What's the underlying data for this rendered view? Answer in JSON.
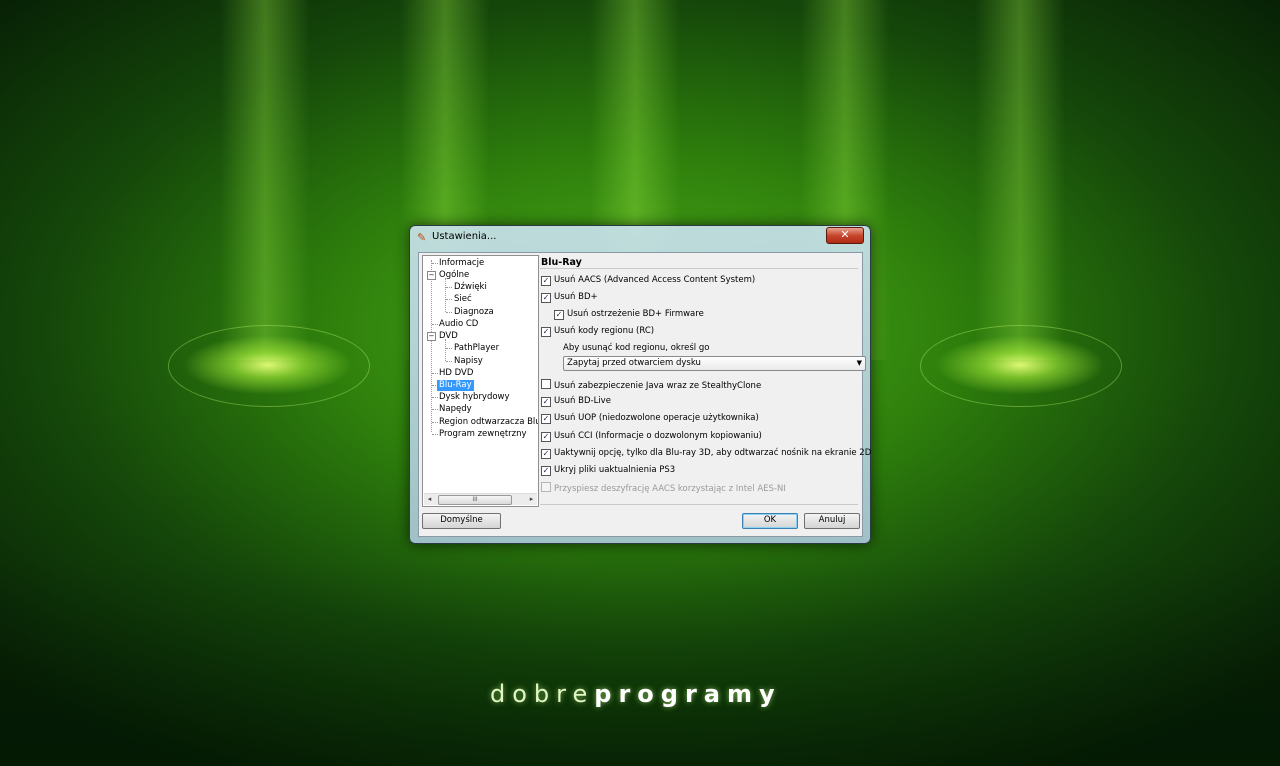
{
  "window": {
    "title": "Ustawienia...",
    "close_symbol": "✕",
    "icon": "wrench-icon"
  },
  "tree": {
    "items": [
      {
        "label": "Informacje"
      },
      {
        "label": "Ogólne",
        "toggle": "−"
      },
      {
        "label": "Dźwięki"
      },
      {
        "label": "Sieć"
      },
      {
        "label": "Diagnoza"
      },
      {
        "label": "Audio CD"
      },
      {
        "label": "DVD",
        "toggle": "−"
      },
      {
        "label": "PathPlayer"
      },
      {
        "label": "Napisy"
      },
      {
        "label": "HD DVD"
      },
      {
        "label": "Blu-Ray",
        "selected": true
      },
      {
        "label": "Dysk hybrydowy"
      },
      {
        "label": "Napędy"
      },
      {
        "label": "Region odtwarzacza Blu-R"
      },
      {
        "label": "Program zewnętrzny"
      }
    ],
    "scroll_left": "◂",
    "scroll_right": "▸",
    "scroll_grip": "III"
  },
  "panel": {
    "title": "Blu-Ray",
    "options": [
      {
        "label": "Usuń AACS (Advanced Access Content System)",
        "checked": true
      },
      {
        "label": "Usuń BD+",
        "checked": true
      },
      {
        "label": "Usuń ostrzeżenie BD+ Firmware",
        "checked": true
      },
      {
        "label": "Usuń kody regionu (RC)",
        "checked": true
      },
      {
        "label": "Usuń zabezpieczenie Java wraz ze StealthyClone",
        "checked": false
      },
      {
        "label": "Usuń BD-Live",
        "checked": true
      },
      {
        "label": "Usuń UOP (niedozwolone operacje użytkownika)",
        "checked": true
      },
      {
        "label": "Usuń CCI (Informacje o dozwolonym kopiowaniu)",
        "checked": true
      },
      {
        "label": "Uaktywnij opcję, tylko dla Blu-ray 3D, aby odtwarzać nośnik na ekranie 2D",
        "checked": true
      },
      {
        "label": "Ukryj pliki uaktualnienia PS3",
        "checked": true
      },
      {
        "label": "Przyspiesz deszyfrację AACS korzystając z Intel AES-NI",
        "checked": false,
        "disabled": true
      }
    ],
    "region_label": "Aby usunąć kod regionu, określ go",
    "region_select": "Zapytaj przed otwarciem dysku",
    "select_caret": "▼"
  },
  "buttons": {
    "defaults": "Domyślne",
    "ok": "OK",
    "cancel": "Anuluj"
  },
  "branding": {
    "logo_light": "dobre",
    "logo_bold": "programy"
  },
  "colors": {
    "selection": "#3399ff",
    "background_green": "#2e7f0c"
  }
}
